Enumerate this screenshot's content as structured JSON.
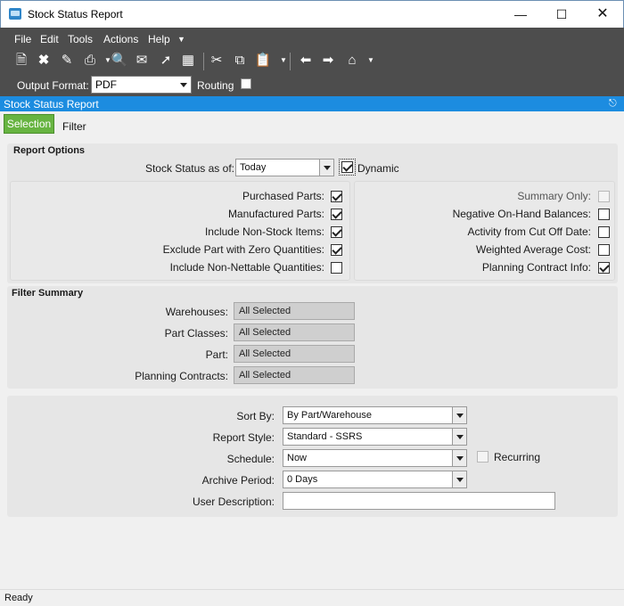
{
  "window": {
    "title": "Stock Status Report",
    "minimize_icon": "minimize-icon",
    "maximize_icon": "maximize-icon",
    "close_icon": "close-icon"
  },
  "menu": {
    "items": [
      "File",
      "Edit",
      "Tools",
      "Actions",
      "Help"
    ]
  },
  "toolbar": {
    "icons": [
      "new-icon",
      "delete-icon",
      "clear-icon",
      "print-icon",
      "print-preview-icon",
      "send-icon",
      "attach-icon",
      "layout-icon",
      "cut-icon",
      "copy-icon",
      "paste-icon",
      "back-icon",
      "forward-icon",
      "home-icon"
    ],
    "output_format_label": "Output Format:",
    "output_format_value": "PDF",
    "routing_label": "Routing",
    "routing_checked": false
  },
  "panel": {
    "title": "Stock Status Report"
  },
  "tabs": {
    "selection": "Selection",
    "filter": "Filter"
  },
  "report_options": {
    "title": "Report Options",
    "stock_status_label": "Stock Status as of:",
    "stock_status_value": "Today",
    "dynamic_label": "Dynamic",
    "dynamic_checked": true,
    "left_options": [
      {
        "label": "Purchased Parts:",
        "checked": true
      },
      {
        "label": "Manufactured Parts:",
        "checked": true
      },
      {
        "label": "Include Non-Stock Items:",
        "checked": true
      },
      {
        "label": "Exclude Part with Zero Quantities:",
        "checked": true
      },
      {
        "label": "Include Non-Nettable Quantities:",
        "checked": false
      }
    ],
    "right_options": [
      {
        "label": "Summary Only:",
        "checked": false,
        "disabled": true
      },
      {
        "label": "Negative On-Hand Balances:",
        "checked": false
      },
      {
        "label": "Activity from Cut Off Date:",
        "checked": false
      },
      {
        "label": "Weighted Average Cost:",
        "checked": false
      },
      {
        "label": "Planning Contract Info:",
        "checked": true
      }
    ]
  },
  "filter_summary": {
    "title": "Filter Summary",
    "rows": [
      {
        "label": "Warehouses:",
        "value": "All Selected"
      },
      {
        "label": "Part Classes:",
        "value": "All Selected"
      },
      {
        "label": "Part:",
        "value": "All Selected"
      },
      {
        "label": "Planning Contracts:",
        "value": "All Selected"
      }
    ]
  },
  "report_settings": {
    "sort_by_label": "Sort By:",
    "sort_by_value": "By Part/Warehouse",
    "report_style_label": "Report Style:",
    "report_style_value": "Standard - SSRS",
    "schedule_label": "Schedule:",
    "schedule_value": "Now",
    "recurring_label": "Recurring",
    "archive_period_label": "Archive Period:",
    "archive_period_value": "0 Days",
    "user_description_label": "User Description:",
    "user_description_value": ""
  },
  "status": {
    "text": "Ready"
  }
}
